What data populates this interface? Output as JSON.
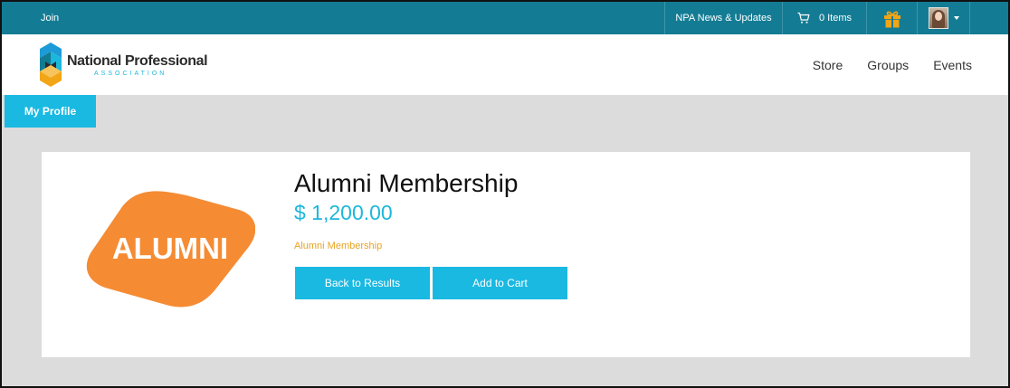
{
  "topbar": {
    "join_label": "Join",
    "news_label": "NPA News & Updates",
    "cart_label": "0 Items",
    "cart_icon": "cart-icon",
    "gift_icon": "gift-icon",
    "avatar": "user-avatar"
  },
  "header": {
    "logo_line1": "National Professional",
    "logo_line2": "ASSOCIATION",
    "nav": [
      "Store",
      "Groups",
      "Events"
    ]
  },
  "profile_tab": {
    "label": "My Profile"
  },
  "product": {
    "image_text": "ALUMNI",
    "title": "Alumni Membership",
    "price": "$ 1,200.00",
    "category": "Alumni Membership",
    "back_label": "Back to Results",
    "add_label": "Add to Cart"
  },
  "colors": {
    "topbar": "#137c94",
    "accent": "#1ab9e2",
    "gift": "#f2a516",
    "orange": "#f58b33",
    "category": "#e8a321",
    "background": "#dcdcdc"
  }
}
